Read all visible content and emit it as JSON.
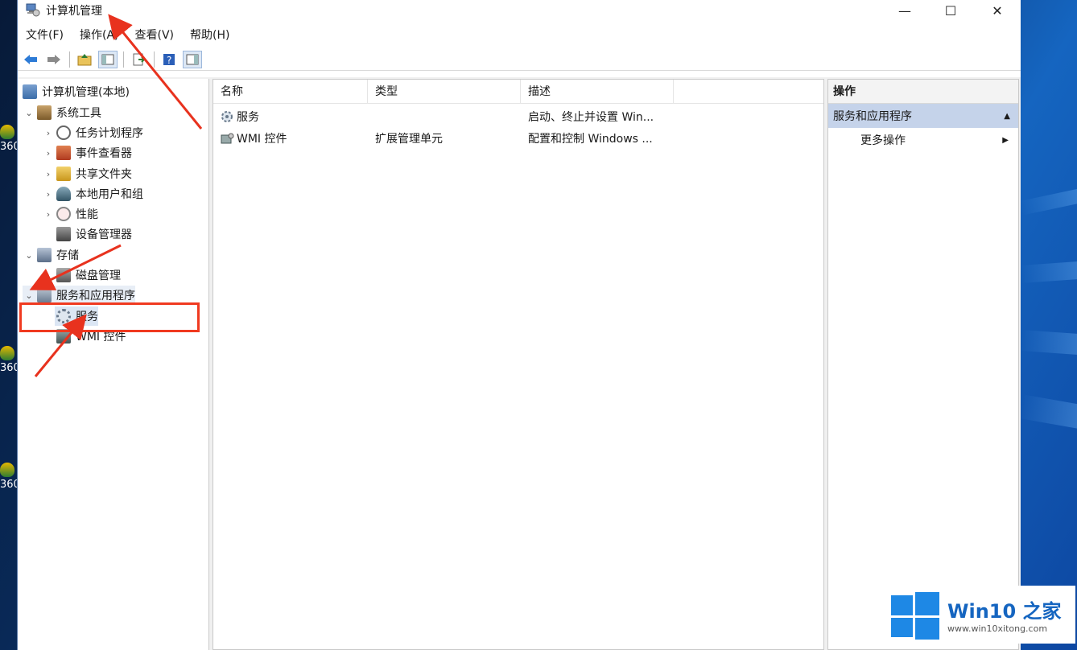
{
  "window": {
    "title": "计算机管理",
    "min_symbol": "—",
    "max_symbol": "☐",
    "close_symbol": "✕"
  },
  "menu": [
    "文件(F)",
    "操作(A)",
    "查看(V)",
    "帮助(H)"
  ],
  "toolbar": {
    "icons": [
      "back-arrow-icon",
      "forward-arrow-icon",
      "up-folder-icon",
      "show-hide-tree-icon",
      "export-list-icon",
      "help-icon",
      "show-hide-action-pane-icon"
    ]
  },
  "tree": {
    "root": "计算机管理(本地)",
    "system_tools": "系统工具",
    "task_scheduler": "任务计划程序",
    "event_viewer": "事件查看器",
    "shared_folders": "共享文件夹",
    "local_users": "本地用户和组",
    "performance": "性能",
    "device_manager": "设备管理器",
    "storage": "存储",
    "disk_management": "磁盘管理",
    "services_apps": "服务和应用程序",
    "services": "服务",
    "wmi": "WMI 控件"
  },
  "list": {
    "columns": [
      "名称",
      "类型",
      "描述"
    ],
    "rows": [
      {
        "name": "服务",
        "type": "",
        "desc": "启动、终止并设置 Win..."
      },
      {
        "name": "WMI 控件",
        "type": "扩展管理单元",
        "desc": "配置和控制 Windows ..."
      }
    ]
  },
  "actions": {
    "title": "操作",
    "section": "服务和应用程序",
    "more": "更多操作"
  },
  "desktop": {
    "icon_labels": [
      "360",
      "360",
      "360"
    ]
  },
  "watermark": {
    "main": "Win10 之家",
    "sub": "www.win10xitong.com"
  },
  "colors": {
    "highlight_box": "#f03a20",
    "arrow": "#e8321e",
    "selection": "#c5d3ea",
    "watermark_blue": "#1565c0"
  }
}
